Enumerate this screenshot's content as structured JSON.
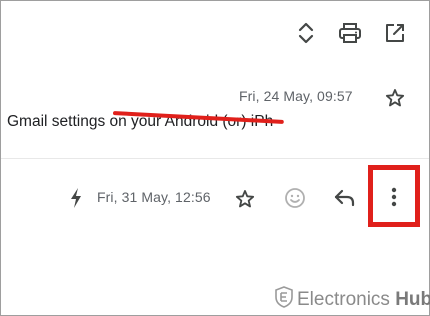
{
  "toolbar": {
    "icons": [
      "unfold-icon",
      "print-icon",
      "open-in-new-window-icon"
    ]
  },
  "email_1": {
    "date": "Fri, 24 May, 09:57",
    "snippet": "Gmail settings on your Android (or) iPh",
    "star_icon": "star-outline-icon"
  },
  "email_2": {
    "date": "Fri, 31 May, 12:56",
    "importance_icon": "lightning-bolt-icon",
    "actions": [
      "star-outline-icon",
      "emoji-reaction-icon",
      "reply-icon",
      "more-vertical-icon"
    ]
  },
  "watermark": {
    "text": "Electronics",
    "bold_text": "Hub"
  },
  "colors": {
    "highlight": "#e0201b",
    "icon": "#444746",
    "muted_text": "#5f6368"
  }
}
